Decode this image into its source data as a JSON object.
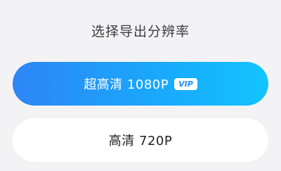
{
  "dialog": {
    "title": "选择导出分辨率",
    "options": [
      {
        "label": "超高清 1080P",
        "badge": "VIP"
      },
      {
        "label": "高清 720P"
      }
    ]
  },
  "colors": {
    "background": "#f3f3f5",
    "primary_gradient_start": "#2d86f5",
    "primary_gradient_end": "#12c4ff",
    "title_text": "#3d3d44"
  }
}
